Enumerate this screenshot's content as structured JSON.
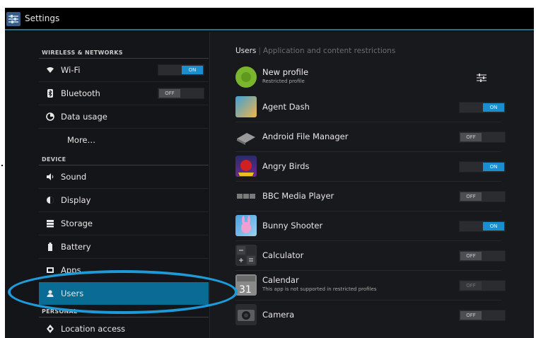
{
  "app": {
    "title": "Settings",
    "icon": "settings-sliders-icon"
  },
  "left_pane": {
    "sections": [
      {
        "header": "WIRELESS & NETWORKS"
      },
      {
        "header": "DEVICE"
      },
      {
        "header": "PERSONAL"
      }
    ],
    "items": [
      {
        "label": "Wi-Fi",
        "icon": "wifi-icon",
        "toggle": "ON"
      },
      {
        "label": "Bluetooth",
        "icon": "bluetooth-icon",
        "toggle": "OFF"
      },
      {
        "label": "Data usage",
        "icon": "data-usage-icon"
      },
      {
        "label": "More…"
      },
      {
        "label": "Sound",
        "icon": "speaker-icon"
      },
      {
        "label": "Display",
        "icon": "display-icon"
      },
      {
        "label": "Storage",
        "icon": "storage-icon"
      },
      {
        "label": "Battery",
        "icon": "battery-icon"
      },
      {
        "label": "Apps",
        "icon": "apps-icon"
      },
      {
        "label": "Users",
        "icon": "user-icon",
        "selected": true
      },
      {
        "label": "Location access",
        "icon": "location-icon"
      }
    ]
  },
  "right_pane": {
    "breadcrumb": {
      "active": "Users",
      "inactive": "Application and content restrictions"
    },
    "profile": {
      "name": "New profile",
      "subtitle": "Restricted profile"
    },
    "apps": [
      {
        "name": "Agent Dash",
        "toggle": "ON",
        "icon": "agent-dash-icon"
      },
      {
        "name": "Android File Manager",
        "toggle": "OFF",
        "icon": "file-manager-icon"
      },
      {
        "name": "Angry Birds",
        "toggle": "ON",
        "icon": "angry-birds-icon"
      },
      {
        "name": "BBC Media Player",
        "toggle": "OFF",
        "icon": "bbc-icon"
      },
      {
        "name": "Bunny Shooter",
        "toggle": "ON",
        "icon": "bunny-shooter-icon"
      },
      {
        "name": "Calculator",
        "toggle": "OFF",
        "icon": "calculator-icon"
      },
      {
        "name": "Calendar",
        "subtitle": "This app is not supported in restricted profiles",
        "toggle": "OFF",
        "disabled": true,
        "icon": "calendar-icon"
      },
      {
        "name": "Camera",
        "toggle": "OFF",
        "icon": "camera-icon"
      }
    ]
  },
  "colors": {
    "accent": "#1a8fcf",
    "selected_bg": "#0a6b95",
    "callout": "#1e9ad8"
  }
}
